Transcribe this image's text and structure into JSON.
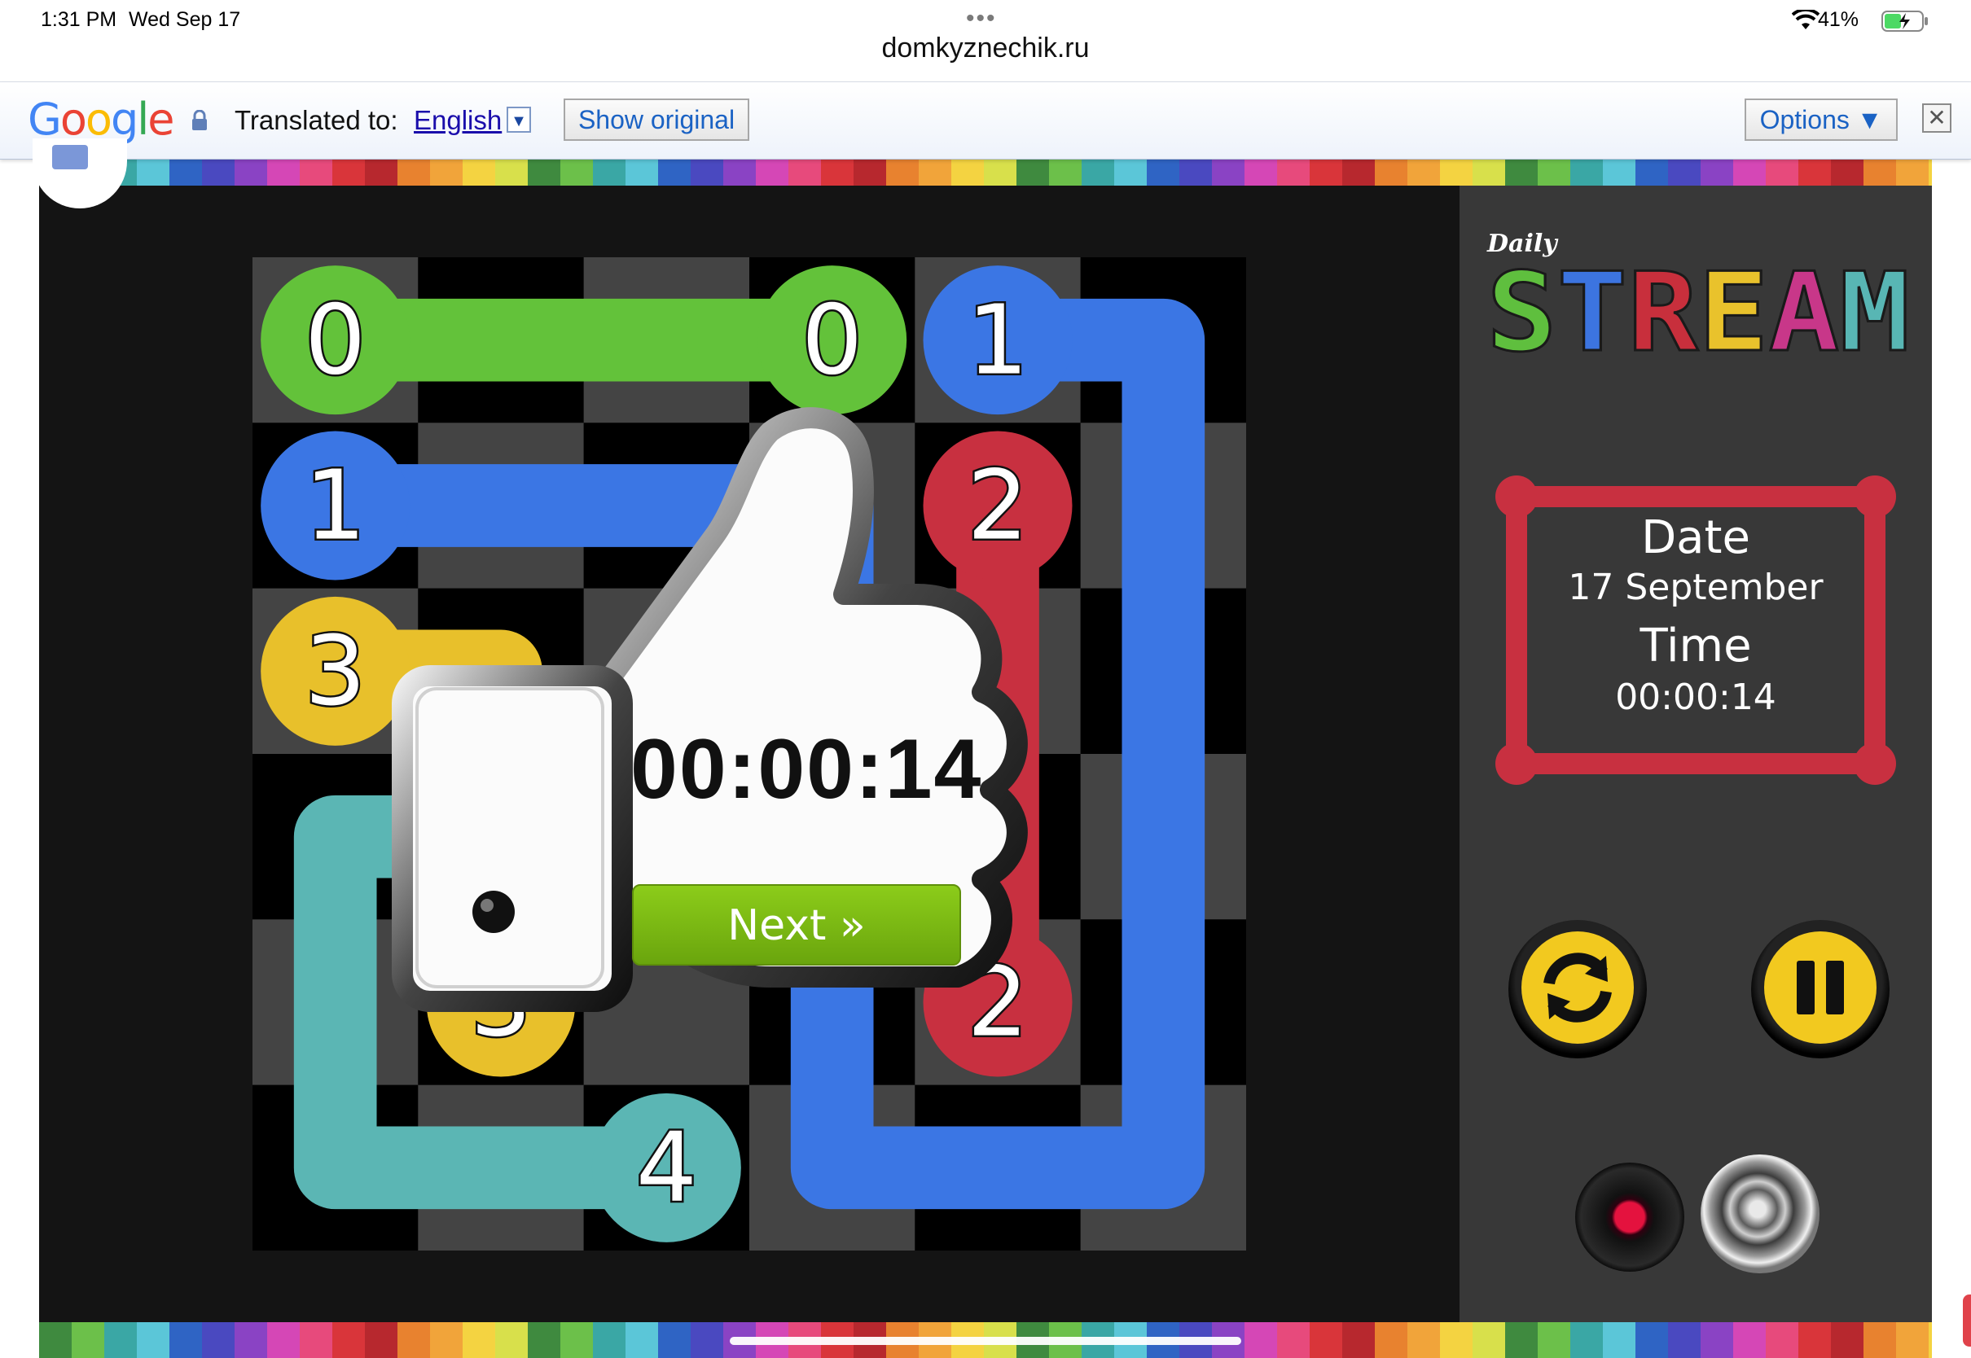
{
  "status_bar": {
    "time": "1:31 PM",
    "date": "Wed Sep 17",
    "battery_percent": "41%",
    "url": "domkyznechik.ru"
  },
  "translate_bar": {
    "logo_letters": [
      "G",
      "o",
      "o",
      "g",
      "l",
      "e"
    ],
    "translated_to_label": "Translated to:",
    "language": "English",
    "language_dropdown_icon": "▼",
    "show_original_label": "Show original",
    "options_label": "Options ▼",
    "close_icon": "close-icon"
  },
  "game": {
    "logo_small": "Daily",
    "logo_big": "STREAM",
    "logo_letters": [
      {
        "ch": "S",
        "color": "#5fbf3e"
      },
      {
        "ch": "T",
        "color": "#3c74e0"
      },
      {
        "ch": "R",
        "color": "#c82f3c"
      },
      {
        "ch": "E",
        "color": "#e9c22c"
      },
      {
        "ch": "A",
        "color": "#c83789"
      },
      {
        "ch": "M",
        "color": "#58b6b4"
      }
    ],
    "date_label": "Date",
    "date_value": "17 September",
    "time_label": "Time",
    "time_value": "00:00:14",
    "colors": {
      "green": "#63c23a",
      "blue": "#3b76e4",
      "red": "#c83040",
      "yellow": "#e8c02b",
      "teal": "#5bb6b4",
      "info_frame": "#c83040",
      "button_yellow": "#f2c91f"
    },
    "grid_size": 6,
    "endpoints": [
      {
        "label": "0",
        "row": 0,
        "col": 0,
        "color": "green"
      },
      {
        "label": "0",
        "row": 0,
        "col": 3,
        "color": "green"
      },
      {
        "label": "1",
        "row": 0,
        "col": 4,
        "color": "blue"
      },
      {
        "label": "1",
        "row": 1,
        "col": 0,
        "color": "blue"
      },
      {
        "label": "2",
        "row": 1,
        "col": 4,
        "color": "red"
      },
      {
        "label": "3",
        "row": 2,
        "col": 0,
        "color": "yellow"
      },
      {
        "label": "3",
        "row": 4,
        "col": 1,
        "color": "yellow"
      },
      {
        "label": "2",
        "row": 4,
        "col": 4,
        "color": "red"
      },
      {
        "label": "4",
        "row": 5,
        "col": 2,
        "color": "teal"
      }
    ],
    "paths": [
      {
        "color": "green",
        "cells": [
          [
            0,
            0
          ],
          [
            0,
            1
          ],
          [
            0,
            2
          ],
          [
            0,
            3
          ]
        ]
      },
      {
        "color": "blue",
        "cells": [
          [
            1,
            0
          ],
          [
            1,
            1
          ],
          [
            1,
            2
          ],
          [
            1,
            3
          ],
          [
            2,
            3
          ],
          [
            3,
            3
          ],
          [
            4,
            3
          ],
          [
            5,
            3
          ],
          [
            5,
            4
          ],
          [
            5,
            5
          ],
          [
            4,
            5
          ],
          [
            3,
            5
          ],
          [
            2,
            5
          ],
          [
            1,
            5
          ],
          [
            0,
            5
          ],
          [
            0,
            4
          ]
        ]
      },
      {
        "color": "red",
        "cells": [
          [
            1,
            4
          ],
          [
            2,
            4
          ],
          [
            3,
            4
          ],
          [
            4,
            4
          ]
        ]
      },
      {
        "color": "yellow",
        "cells": [
          [
            2,
            0
          ],
          [
            2,
            1
          ],
          [
            3,
            1
          ],
          [
            4,
            1
          ]
        ]
      },
      {
        "color": "teal",
        "cells": [
          [
            5,
            2
          ],
          [
            5,
            1
          ],
          [
            5,
            0
          ],
          [
            4,
            0
          ],
          [
            3,
            0
          ],
          [
            3,
            1
          ],
          [
            3,
            2
          ]
        ]
      }
    ],
    "buttons": {
      "refresh_icon": "refresh-icon",
      "pause_icon": "pause-icon",
      "record_icon": "record-disc-icon",
      "sound_icon": "speaker-icon"
    }
  },
  "success_popup": {
    "time": "00:00:14",
    "next_label": "Next »",
    "thumb_icon": "thumbs-up-icon"
  }
}
